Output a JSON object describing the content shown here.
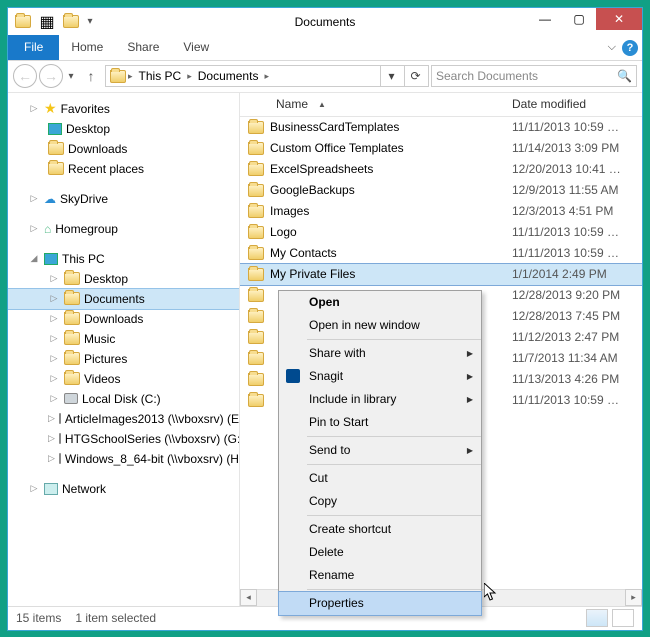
{
  "window": {
    "title": "Documents"
  },
  "ribbon": {
    "file": "File",
    "home": "Home",
    "share": "Share",
    "view": "View"
  },
  "address": {
    "pc": "This PC",
    "folder": "Documents"
  },
  "search": {
    "placeholder": "Search Documents"
  },
  "tree": {
    "favorites": {
      "label": "Favorites",
      "items": [
        "Desktop",
        "Downloads",
        "Recent places"
      ]
    },
    "skydrive": {
      "label": "SkyDrive"
    },
    "homegroup": {
      "label": "Homegroup"
    },
    "thispc": {
      "label": "This PC",
      "items": [
        "Desktop",
        "Documents",
        "Downloads",
        "Music",
        "Pictures",
        "Videos",
        "Local Disk (C:)",
        "ArticleImages2013 (\\\\vboxsrv) (E:)",
        "HTGSchoolSeries (\\\\vboxsrv) (G:)",
        "Windows_8_64-bit (\\\\vboxsrv) (H:)"
      ],
      "active_index": 1
    },
    "network": {
      "label": "Network"
    }
  },
  "columns": {
    "name": "Name",
    "date": "Date modified"
  },
  "files": [
    {
      "name": "BusinessCardTemplates",
      "date": "11/11/2013 10:59 …"
    },
    {
      "name": "Custom Office Templates",
      "date": "11/14/2013 3:09 PM"
    },
    {
      "name": "ExcelSpreadsheets",
      "date": "12/20/2013 10:41 …"
    },
    {
      "name": "GoogleBackups",
      "date": "12/9/2013 11:55 AM"
    },
    {
      "name": "Images",
      "date": "12/3/2013 4:51 PM"
    },
    {
      "name": "Logo",
      "date": "11/11/2013 10:59 …"
    },
    {
      "name": "My Contacts",
      "date": "11/11/2013 10:59 …"
    },
    {
      "name": "My Private Files",
      "date": "1/1/2014 2:49 PM",
      "selected": true
    },
    {
      "name": "",
      "date": "12/28/2013 9:20 PM"
    },
    {
      "name": "",
      "date": "12/28/2013 7:45 PM"
    },
    {
      "name": "",
      "date": "11/12/2013 2:47 PM"
    },
    {
      "name": "",
      "date": "11/7/2013 11:34 AM"
    },
    {
      "name": "",
      "date": "11/13/2013 4:26 PM"
    },
    {
      "name": "",
      "date": "11/11/2013 10:59 …"
    }
  ],
  "context_menu": {
    "open": "Open",
    "open_new": "Open in new window",
    "share_with": "Share with",
    "snagit": "Snagit",
    "include": "Include in library",
    "pin": "Pin to Start",
    "send_to": "Send to",
    "cut": "Cut",
    "copy": "Copy",
    "shortcut": "Create shortcut",
    "delete": "Delete",
    "rename": "Rename",
    "properties": "Properties"
  },
  "status": {
    "items": "15 items",
    "selected": "1 item selected"
  }
}
